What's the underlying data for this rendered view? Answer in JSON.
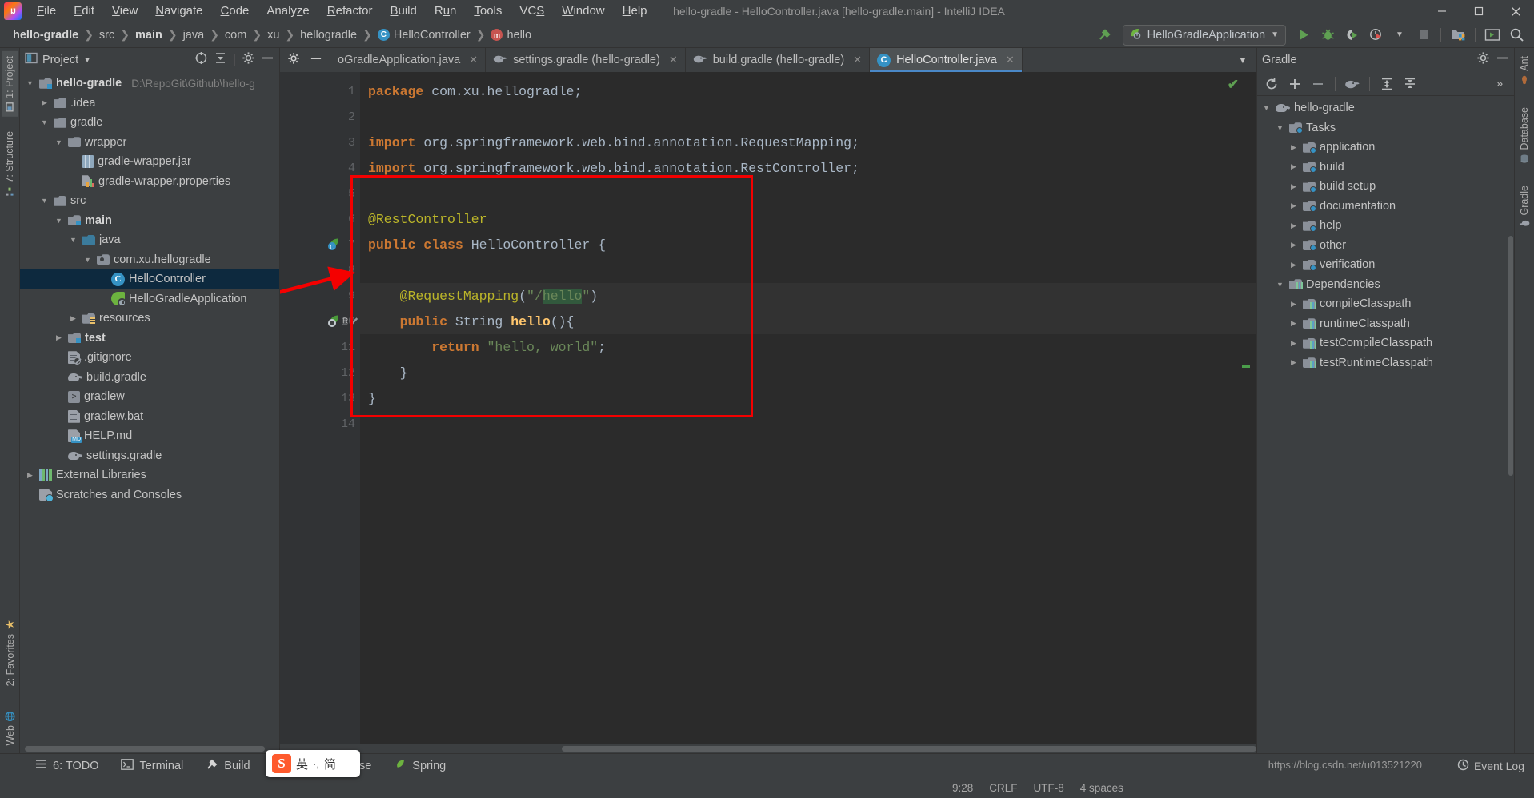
{
  "window": {
    "title": "hello-gradle - HelloController.java [hello-gradle.main] - IntelliJ IDEA",
    "minimize": "—",
    "maximize": "▢",
    "close": "✕"
  },
  "menubar": [
    {
      "label": "File",
      "mnemonic": "F"
    },
    {
      "label": "Edit",
      "mnemonic": "E"
    },
    {
      "label": "View",
      "mnemonic": "V"
    },
    {
      "label": "Navigate",
      "mnemonic": "N"
    },
    {
      "label": "Code",
      "mnemonic": "C"
    },
    {
      "label": "Analyze",
      "mnemonic": "z"
    },
    {
      "label": "Refactor",
      "mnemonic": "R"
    },
    {
      "label": "Build",
      "mnemonic": "B"
    },
    {
      "label": "Run",
      "mnemonic": "u"
    },
    {
      "label": "Tools",
      "mnemonic": "T"
    },
    {
      "label": "VCS",
      "mnemonic": "S"
    },
    {
      "label": "Window",
      "mnemonic": "W"
    },
    {
      "label": "Help",
      "mnemonic": "H"
    }
  ],
  "breadcrumbs": [
    {
      "label": "hello-gradle",
      "bold": true,
      "icon": null
    },
    {
      "label": "src",
      "bold": false,
      "icon": null
    },
    {
      "label": "main",
      "bold": true,
      "icon": null
    },
    {
      "label": "java",
      "bold": false,
      "icon": null
    },
    {
      "label": "com",
      "bold": false,
      "icon": null
    },
    {
      "label": "xu",
      "bold": false,
      "icon": null
    },
    {
      "label": "hellogradle",
      "bold": false,
      "icon": null
    },
    {
      "label": "HelloController",
      "bold": false,
      "icon": "class-icon"
    },
    {
      "label": "hello",
      "bold": false,
      "icon": "method-icon"
    }
  ],
  "toolbar": {
    "run_configuration": "HelloGradleApplication",
    "dropdown_caret": "▼",
    "buttons": [
      {
        "name": "build-hammer-icon",
        "glyph": "🔨"
      },
      {
        "name": "run-button",
        "glyph": "▶"
      },
      {
        "name": "debug-button",
        "glyph": "🐞"
      },
      {
        "name": "run-with-coverage-button",
        "glyph": "◗"
      },
      {
        "name": "profiler-button",
        "glyph": "◷"
      },
      {
        "name": "stop-button",
        "glyph": "■"
      },
      {
        "name": "project-structure-button",
        "glyph": "▤"
      },
      {
        "name": "terminal-button",
        "glyph": "▭"
      },
      {
        "name": "search-everywhere-button",
        "glyph": "🔍"
      }
    ]
  },
  "left_strip": [
    {
      "label": "1: Project",
      "active": true,
      "icon": "project-icon"
    },
    {
      "label": "7: Structure",
      "active": false,
      "icon": "structure-icon"
    },
    {
      "label": "2: Favorites",
      "active": false,
      "icon": "favorites-icon"
    },
    {
      "label": "Web",
      "active": false,
      "icon": "web-icon"
    }
  ],
  "right_strip": [
    {
      "label": "Ant",
      "icon": "ant-icon"
    },
    {
      "label": "Database",
      "icon": "database-icon"
    },
    {
      "label": "Gradle",
      "icon": "gradle-icon"
    }
  ],
  "project_panel": {
    "title": "Project",
    "caret": "▼",
    "actions": [
      "locate-icon",
      "collapse-all-icon",
      "settings-gear-icon",
      "hide-icon"
    ],
    "tree": [
      {
        "indent": 0,
        "arrow": "▼",
        "icon": "module-folder",
        "label": "hello-gradle",
        "bold": true,
        "path": "D:\\RepoGit\\Github\\hello-g",
        "selected": false
      },
      {
        "indent": 1,
        "arrow": "▶",
        "icon": "folder",
        "label": ".idea",
        "bold": false,
        "path": "",
        "selected": false
      },
      {
        "indent": 1,
        "arrow": "▼",
        "icon": "folder",
        "label": "gradle",
        "bold": false,
        "path": "",
        "selected": false
      },
      {
        "indent": 2,
        "arrow": "▼",
        "icon": "folder",
        "label": "wrapper",
        "bold": false,
        "path": "",
        "selected": false
      },
      {
        "indent": 3,
        "arrow": "",
        "icon": "jar",
        "label": "gradle-wrapper.jar",
        "bold": false,
        "path": "",
        "selected": false
      },
      {
        "indent": 3,
        "arrow": "",
        "icon": "properties",
        "label": "gradle-wrapper.properties",
        "bold": false,
        "path": "",
        "selected": false
      },
      {
        "indent": 1,
        "arrow": "▼",
        "icon": "folder",
        "label": "src",
        "bold": false,
        "path": "",
        "selected": false
      },
      {
        "indent": 2,
        "arrow": "▼",
        "icon": "source-folder",
        "label": "main",
        "bold": true,
        "path": "",
        "selected": false
      },
      {
        "indent": 3,
        "arrow": "▼",
        "icon": "java-folder",
        "label": "java",
        "bold": false,
        "path": "",
        "selected": false
      },
      {
        "indent": 4,
        "arrow": "▼",
        "icon": "package",
        "label": "com.xu.hellogradle",
        "bold": false,
        "path": "",
        "selected": false
      },
      {
        "indent": 5,
        "arrow": "",
        "icon": "class",
        "label": "HelloController",
        "bold": false,
        "path": "",
        "selected": true
      },
      {
        "indent": 5,
        "arrow": "",
        "icon": "spring-boot-class",
        "label": "HelloGradleApplication",
        "bold": false,
        "path": "",
        "selected": false
      },
      {
        "indent": 3,
        "arrow": "▶",
        "icon": "resources-folder",
        "label": "resources",
        "bold": false,
        "path": "",
        "selected": false
      },
      {
        "indent": 2,
        "arrow": "▶",
        "icon": "test-folder",
        "label": "test",
        "bold": true,
        "path": "",
        "selected": false
      },
      {
        "indent": 2,
        "arrow": "",
        "icon": "gitignore",
        "label": ".gitignore",
        "bold": false,
        "path": "",
        "selected": false
      },
      {
        "indent": 2,
        "arrow": "",
        "icon": "gradle-file",
        "label": "build.gradle",
        "bold": false,
        "path": "",
        "selected": false
      },
      {
        "indent": 2,
        "arrow": "",
        "icon": "shell",
        "label": "gradlew",
        "bold": false,
        "path": "",
        "selected": false
      },
      {
        "indent": 2,
        "arrow": "",
        "icon": "bat",
        "label": "gradlew.bat",
        "bold": false,
        "path": "",
        "selected": false
      },
      {
        "indent": 2,
        "arrow": "",
        "icon": "markdown",
        "label": "HELP.md",
        "bold": false,
        "path": "",
        "selected": false
      },
      {
        "indent": 2,
        "arrow": "",
        "icon": "gradle-file",
        "label": "settings.gradle",
        "bold": false,
        "path": "",
        "selected": false
      },
      {
        "indent": 0,
        "arrow": "▶",
        "icon": "libraries",
        "label": "External Libraries",
        "bold": false,
        "path": "",
        "selected": false
      },
      {
        "indent": 0,
        "arrow": "",
        "icon": "scratches",
        "label": "Scratches and Consoles",
        "bold": false,
        "path": "",
        "selected": false
      }
    ]
  },
  "editor": {
    "tabs": [
      {
        "label": "oGradleApplication.java",
        "icon": "class-icon",
        "active": false,
        "close": "✕"
      },
      {
        "label": "settings.gradle (hello-gradle)",
        "icon": "gradle-icon",
        "active": false,
        "close": "✕"
      },
      {
        "label": "build.gradle (hello-gradle)",
        "icon": "gradle-icon",
        "active": false,
        "close": "✕"
      },
      {
        "label": "HelloController.java",
        "icon": "class-icon",
        "active": true,
        "close": "✕"
      }
    ],
    "tab_list_caret": "▼",
    "inspection_status": "✔",
    "line_numbers": [
      "1",
      "2",
      "3",
      "4",
      "5",
      "6",
      "7",
      "8",
      "9",
      "10",
      "11",
      "12",
      "13",
      "14"
    ],
    "code_lines": [
      {
        "n": 1,
        "tokens": [
          {
            "t": "package ",
            "c": "k"
          },
          {
            "t": "com.xu.hellogradle;",
            "c": "id"
          }
        ]
      },
      {
        "n": 2,
        "tokens": []
      },
      {
        "n": 3,
        "tokens": [
          {
            "t": "import ",
            "c": "k"
          },
          {
            "t": "org.springframework.web.bind.annotation.RequestMapping;",
            "c": "id"
          }
        ]
      },
      {
        "n": 4,
        "tokens": [
          {
            "t": "import ",
            "c": "k"
          },
          {
            "t": "org.springframework.web.bind.annotation.RestController;",
            "c": "id"
          }
        ]
      },
      {
        "n": 5,
        "tokens": []
      },
      {
        "n": 6,
        "tokens": [
          {
            "t": "@RestController",
            "c": "ann"
          }
        ]
      },
      {
        "n": 7,
        "tokens": [
          {
            "t": "public class ",
            "c": "k"
          },
          {
            "t": "HelloController ",
            "c": "id"
          },
          {
            "t": "{",
            "c": "pl"
          }
        ]
      },
      {
        "n": 8,
        "tokens": []
      },
      {
        "n": 9,
        "tokens": [
          {
            "t": "    @RequestMapping",
            "c": "ann"
          },
          {
            "t": "(",
            "c": "pl"
          },
          {
            "t": "\"/",
            "c": "str"
          },
          {
            "t": "hello",
            "c": "strhl"
          },
          {
            "t": "\"",
            "c": "str"
          },
          {
            "t": ")",
            "c": "pl"
          }
        ]
      },
      {
        "n": 10,
        "tokens": [
          {
            "t": "    public ",
            "c": "k"
          },
          {
            "t": "String ",
            "c": "id"
          },
          {
            "t": "hello",
            "c": "mth"
          },
          {
            "t": "(){",
            "c": "pl"
          }
        ]
      },
      {
        "n": 11,
        "tokens": [
          {
            "t": "        return ",
            "c": "k"
          },
          {
            "t": "\"hello, world\"",
            "c": "str"
          },
          {
            "t": ";",
            "c": "pl"
          }
        ]
      },
      {
        "n": 12,
        "tokens": [
          {
            "t": "    }",
            "c": "pl"
          }
        ]
      },
      {
        "n": 13,
        "tokens": [
          {
            "t": "}",
            "c": "pl"
          }
        ]
      },
      {
        "n": 14,
        "tokens": []
      }
    ]
  },
  "gradle_panel": {
    "title": "Gradle",
    "header_actions": [
      "settings-gear-icon",
      "hide-icon"
    ],
    "toolbar": [
      "refresh-icon",
      "add-icon",
      "remove-icon",
      "execute-gradle-task-icon",
      "expand-all-icon",
      "collapse-all-icon",
      "more-icon"
    ],
    "tree": [
      {
        "indent": 0,
        "arrow": "▼",
        "icon": "gradle-elephant",
        "label": "hello-gradle"
      },
      {
        "indent": 1,
        "arrow": "▼",
        "icon": "tasks-folder",
        "label": "Tasks"
      },
      {
        "indent": 2,
        "arrow": "▶",
        "icon": "tasks-folder",
        "label": "application"
      },
      {
        "indent": 2,
        "arrow": "▶",
        "icon": "tasks-folder",
        "label": "build"
      },
      {
        "indent": 2,
        "arrow": "▶",
        "icon": "tasks-folder",
        "label": "build setup"
      },
      {
        "indent": 2,
        "arrow": "▶",
        "icon": "tasks-folder",
        "label": "documentation"
      },
      {
        "indent": 2,
        "arrow": "▶",
        "icon": "tasks-folder",
        "label": "help"
      },
      {
        "indent": 2,
        "arrow": "▶",
        "icon": "tasks-folder",
        "label": "other"
      },
      {
        "indent": 2,
        "arrow": "▶",
        "icon": "tasks-folder",
        "label": "verification"
      },
      {
        "indent": 1,
        "arrow": "▼",
        "icon": "dependencies-folder",
        "label": "Dependencies"
      },
      {
        "indent": 2,
        "arrow": "▶",
        "icon": "dependencies-folder",
        "label": "compileClasspath"
      },
      {
        "indent": 2,
        "arrow": "▶",
        "icon": "dependencies-folder",
        "label": "runtimeClasspath"
      },
      {
        "indent": 2,
        "arrow": "▶",
        "icon": "dependencies-folder",
        "label": "testCompileClasspath"
      },
      {
        "indent": 2,
        "arrow": "▶",
        "icon": "dependencies-folder",
        "label": "testRuntimeClasspath"
      }
    ]
  },
  "bottom_bar": [
    {
      "label": "6: TODO",
      "icon": "todo-icon"
    },
    {
      "label": "Terminal",
      "icon": "terminal-icon"
    },
    {
      "label": "Build",
      "icon": "build-icon"
    },
    {
      "label": "Java Enterprise",
      "icon": "java-enterprise-icon"
    },
    {
      "label": "Spring",
      "icon": "spring-icon"
    }
  ],
  "status_bar": {
    "caret_position": "9:28",
    "line_separator": "CRLF",
    "encoding": "UTF-8",
    "indent": "4 spaces",
    "event_log": "Event Log",
    "watermark": "https://blog.csdn.net/u013521220"
  },
  "ime": {
    "logo": "S",
    "mode": "英",
    "dots": "·,",
    "style": "简"
  },
  "colors": {
    "accent_blue": "#4a88c7",
    "selection": "#0d293e",
    "highlight_red": "#f40000",
    "keyword": "#cc7832",
    "string": "#6a8759",
    "annotation": "#bbb529",
    "method": "#ffc66d",
    "identifier": "#a9b7c6"
  }
}
